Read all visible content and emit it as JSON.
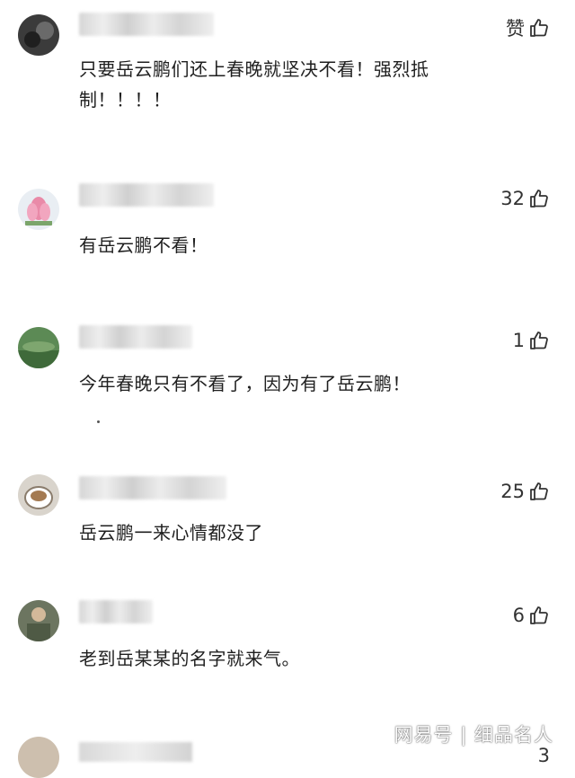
{
  "comments": [
    {
      "text": "只要岳云鹏们还上春晚就坚决不看！强烈抵制！！！！",
      "likes": "赞"
    },
    {
      "text": "有岳云鹏不看！",
      "likes": "32"
    },
    {
      "text": "今年春晚只有不看了，因为有了岳云鹏！",
      "likes": "1"
    },
    {
      "text": "岳云鹏一来心情都没了",
      "likes": "25"
    },
    {
      "text": "老到岳某某的名字就来气。",
      "likes": "6"
    },
    {
      "text": "",
      "likes": "3"
    }
  ],
  "watermark": "网易号 | 细品名人",
  "icons": {
    "like": "thumbs-up-icon"
  }
}
